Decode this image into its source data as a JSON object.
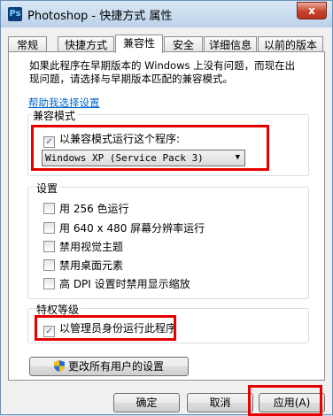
{
  "window": {
    "title": "Photoshop - 快捷方式 属性",
    "app_icon_text": "Ps",
    "close_glyph": "x"
  },
  "tabs": [
    {
      "label": "常规"
    },
    {
      "label": "快捷方式"
    },
    {
      "label": "兼容性",
      "active": true
    },
    {
      "label": "安全"
    },
    {
      "label": "详细信息"
    },
    {
      "label": "以前的版本"
    }
  ],
  "intro": {
    "line1": "如果此程序在早期版本的 Windows 上没有问题，而现在出",
    "line2": "现问题，请选择与早期版本匹配的兼容模式。"
  },
  "help_link": "帮助我选择设置",
  "compat_mode": {
    "title": "兼容模式",
    "checkbox_label": "以兼容模式运行这个程序:",
    "checked": true,
    "selected_os": "Windows XP (Service Pack 3)"
  },
  "settings": {
    "title": "设置",
    "options": [
      {
        "label": "用 256 色运行",
        "checked": false
      },
      {
        "label": "用 640 x 480 屏幕分辨率运行",
        "checked": false
      },
      {
        "label": "禁用视觉主题",
        "checked": false
      },
      {
        "label": "禁用桌面元素",
        "checked": false
      },
      {
        "label": "高 DPI 设置时禁用显示缩放",
        "checked": false
      }
    ]
  },
  "privilege": {
    "title": "特权等级",
    "checkbox_label": "以管理员身份运行此程序",
    "checked": true
  },
  "change_all_users_label": "更改所有用户的设置",
  "buttons": {
    "ok": "确定",
    "cancel": "取消",
    "apply": "应用(A)"
  },
  "colors": {
    "highlight_red": "#e60000",
    "link_blue": "#0066cc"
  }
}
